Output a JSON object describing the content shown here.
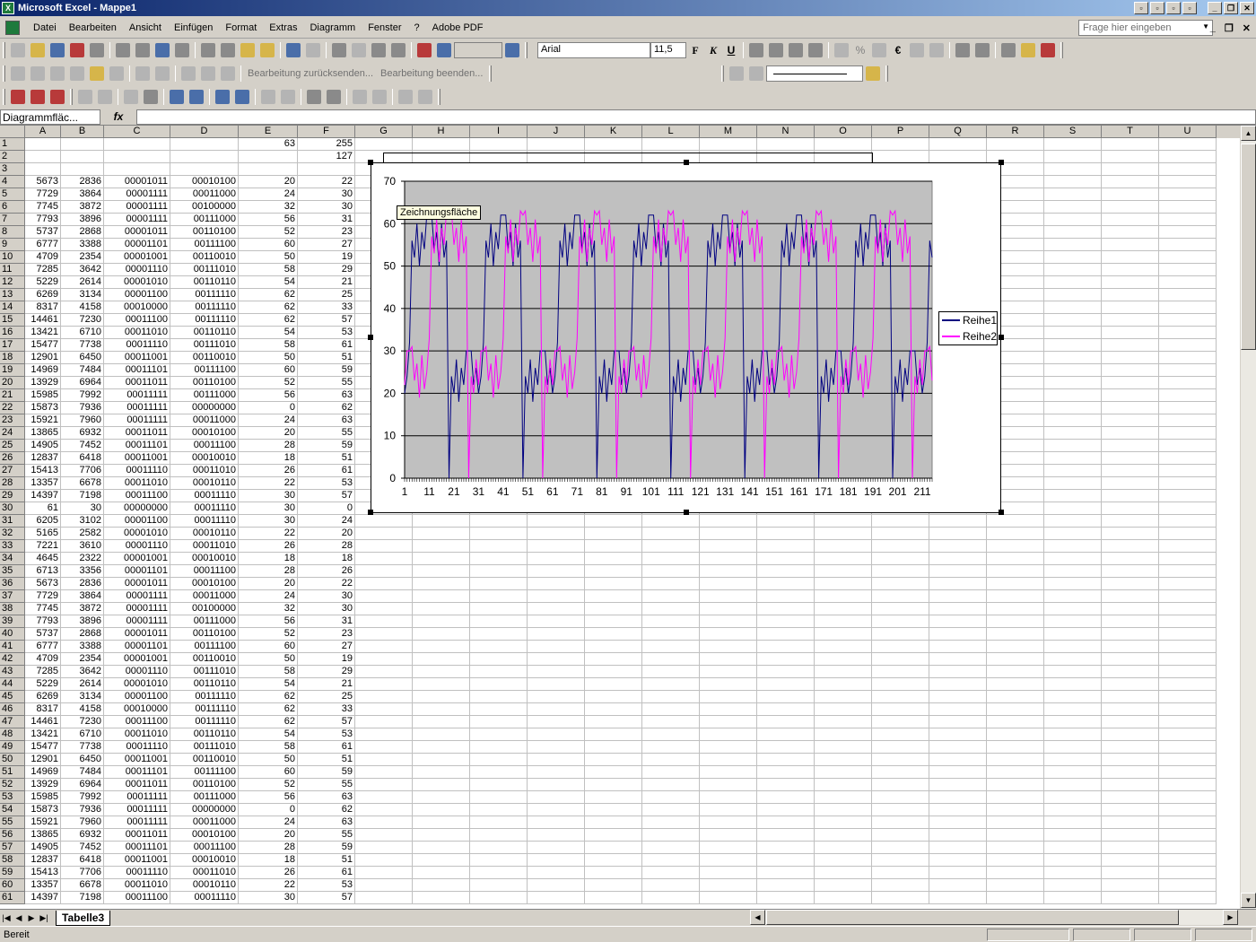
{
  "window": {
    "title": "Microsoft Excel - Mappe1"
  },
  "menu": {
    "items": [
      "Datei",
      "Bearbeiten",
      "Ansicht",
      "Einfügen",
      "Format",
      "Extras",
      "Diagramm",
      "Fenster",
      "?",
      "Adobe PDF"
    ],
    "help_placeholder": "Frage hier eingeben"
  },
  "toolbar": {
    "font_name": "Arial",
    "font_size": "11,5",
    "bold": "F",
    "italic": "K",
    "underline": "U",
    "euro": "€",
    "percent": "%",
    "review_reply": "Bearbeitung zurücksenden...",
    "review_end": "Bearbeitung beenden..."
  },
  "formula_bar": {
    "name_box": "Diagrammfläc...",
    "fx": "fx"
  },
  "columns": [
    "A",
    "B",
    "C",
    "D",
    "E",
    "F",
    "G",
    "H",
    "I",
    "J",
    "K",
    "L",
    "M",
    "N",
    "O",
    "P",
    "Q",
    "R",
    "S",
    "T",
    "U"
  ],
  "rows": [
    [
      "1",
      "",
      "",
      "",
      "",
      "63",
      "255"
    ],
    [
      "2",
      "",
      "",
      "",
      "",
      "",
      "127"
    ],
    [
      "3",
      "",
      "",
      "",
      "",
      "",
      ""
    ],
    [
      "4",
      "5673",
      "2836",
      "00001011",
      "00010100",
      "20",
      "22"
    ],
    [
      "5",
      "7729",
      "3864",
      "00001111",
      "00011000",
      "24",
      "30"
    ],
    [
      "6",
      "7745",
      "3872",
      "00001111",
      "00100000",
      "32",
      "30"
    ],
    [
      "7",
      "7793",
      "3896",
      "00001111",
      "00111000",
      "56",
      "31"
    ],
    [
      "8",
      "5737",
      "2868",
      "00001011",
      "00110100",
      "52",
      "23"
    ],
    [
      "9",
      "6777",
      "3388",
      "00001101",
      "00111100",
      "60",
      "27"
    ],
    [
      "10",
      "4709",
      "2354",
      "00001001",
      "00110010",
      "50",
      "19"
    ],
    [
      "11",
      "7285",
      "3642",
      "00001110",
      "00111010",
      "58",
      "29"
    ],
    [
      "12",
      "5229",
      "2614",
      "00001010",
      "00110110",
      "54",
      "21"
    ],
    [
      "13",
      "6269",
      "3134",
      "00001100",
      "00111110",
      "62",
      "25"
    ],
    [
      "14",
      "8317",
      "4158",
      "00010000",
      "00111110",
      "62",
      "33"
    ],
    [
      "15",
      "14461",
      "7230",
      "00011100",
      "00111110",
      "62",
      "57"
    ],
    [
      "16",
      "13421",
      "6710",
      "00011010",
      "00110110",
      "54",
      "53"
    ],
    [
      "17",
      "15477",
      "7738",
      "00011110",
      "00111010",
      "58",
      "61"
    ],
    [
      "18",
      "12901",
      "6450",
      "00011001",
      "00110010",
      "50",
      "51"
    ],
    [
      "19",
      "14969",
      "7484",
      "00011101",
      "00111100",
      "60",
      "59"
    ],
    [
      "20",
      "13929",
      "6964",
      "00011011",
      "00110100",
      "52",
      "55"
    ],
    [
      "21",
      "15985",
      "7992",
      "00011111",
      "00111000",
      "56",
      "63"
    ],
    [
      "22",
      "15873",
      "7936",
      "00011111",
      "00000000",
      "0",
      "62"
    ],
    [
      "23",
      "15921",
      "7960",
      "00011111",
      "00011000",
      "24",
      "63"
    ],
    [
      "24",
      "13865",
      "6932",
      "00011011",
      "00010100",
      "20",
      "55"
    ],
    [
      "25",
      "14905",
      "7452",
      "00011101",
      "00011100",
      "28",
      "59"
    ],
    [
      "26",
      "12837",
      "6418",
      "00011001",
      "00010010",
      "18",
      "51"
    ],
    [
      "27",
      "15413",
      "7706",
      "00011110",
      "00011010",
      "26",
      "61"
    ],
    [
      "28",
      "13357",
      "6678",
      "00011010",
      "00010110",
      "22",
      "53"
    ],
    [
      "29",
      "14397",
      "7198",
      "00011100",
      "00011110",
      "30",
      "57"
    ],
    [
      "30",
      "61",
      "30",
      "00000000",
      "00011110",
      "30",
      "0"
    ],
    [
      "31",
      "6205",
      "3102",
      "00001100",
      "00011110",
      "30",
      "24"
    ],
    [
      "32",
      "5165",
      "2582",
      "00001010",
      "00010110",
      "22",
      "20"
    ],
    [
      "33",
      "7221",
      "3610",
      "00001110",
      "00011010",
      "26",
      "28"
    ],
    [
      "34",
      "4645",
      "2322",
      "00001001",
      "00010010",
      "18",
      "18"
    ],
    [
      "35",
      "6713",
      "3356",
      "00001101",
      "00011100",
      "28",
      "26"
    ],
    [
      "36",
      "5673",
      "2836",
      "00001011",
      "00010100",
      "20",
      "22"
    ],
    [
      "37",
      "7729",
      "3864",
      "00001111",
      "00011000",
      "24",
      "30"
    ],
    [
      "38",
      "7745",
      "3872",
      "00001111",
      "00100000",
      "32",
      "30"
    ],
    [
      "39",
      "7793",
      "3896",
      "00001111",
      "00111000",
      "56",
      "31"
    ],
    [
      "40",
      "5737",
      "2868",
      "00001011",
      "00110100",
      "52",
      "23"
    ],
    [
      "41",
      "6777",
      "3388",
      "00001101",
      "00111100",
      "60",
      "27"
    ],
    [
      "42",
      "4709",
      "2354",
      "00001001",
      "00110010",
      "50",
      "19"
    ],
    [
      "43",
      "7285",
      "3642",
      "00001110",
      "00111010",
      "58",
      "29"
    ],
    [
      "44",
      "5229",
      "2614",
      "00001010",
      "00110110",
      "54",
      "21"
    ],
    [
      "45",
      "6269",
      "3134",
      "00001100",
      "00111110",
      "62",
      "25"
    ],
    [
      "46",
      "8317",
      "4158",
      "00010000",
      "00111110",
      "62",
      "33"
    ],
    [
      "47",
      "14461",
      "7230",
      "00011100",
      "00111110",
      "62",
      "57"
    ],
    [
      "48",
      "13421",
      "6710",
      "00011010",
      "00110110",
      "54",
      "53"
    ],
    [
      "49",
      "15477",
      "7738",
      "00011110",
      "00111010",
      "58",
      "61"
    ],
    [
      "50",
      "12901",
      "6450",
      "00011001",
      "00110010",
      "50",
      "51"
    ],
    [
      "51",
      "14969",
      "7484",
      "00011101",
      "00111100",
      "60",
      "59"
    ],
    [
      "52",
      "13929",
      "6964",
      "00011011",
      "00110100",
      "52",
      "55"
    ],
    [
      "53",
      "15985",
      "7992",
      "00011111",
      "00111000",
      "56",
      "63"
    ],
    [
      "54",
      "15873",
      "7936",
      "00011111",
      "00000000",
      "0",
      "62"
    ],
    [
      "55",
      "15921",
      "7960",
      "00011111",
      "00011000",
      "24",
      "63"
    ],
    [
      "56",
      "13865",
      "6932",
      "00011011",
      "00010100",
      "20",
      "55"
    ],
    [
      "57",
      "14905",
      "7452",
      "00011101",
      "00011100",
      "28",
      "59"
    ],
    [
      "58",
      "12837",
      "6418",
      "00011001",
      "00010010",
      "18",
      "51"
    ],
    [
      "59",
      "15413",
      "7706",
      "00011110",
      "00011010",
      "26",
      "61"
    ],
    [
      "60",
      "13357",
      "6678",
      "00011010",
      "00010110",
      "22",
      "53"
    ],
    [
      "61",
      "14397",
      "7198",
      "00011100",
      "00011110",
      "30",
      "57"
    ]
  ],
  "chart": {
    "tooltip": "Zeichnungsfläche",
    "plot_bg": "#c0c0c0",
    "series_colors": [
      "#000080",
      "#ff00ff"
    ]
  },
  "chart_data": {
    "type": "line",
    "title": "",
    "xlabel": "",
    "ylabel": "",
    "ylim": [
      0,
      70
    ],
    "yticks": [
      0,
      10,
      20,
      30,
      40,
      50,
      60,
      70
    ],
    "xlim": [
      1,
      215
    ],
    "xtick_labels": [
      "1",
      "11",
      "21",
      "31",
      "41",
      "51",
      "61",
      "71",
      "81",
      "91",
      "101",
      "111",
      "121",
      "131",
      "141",
      "151",
      "161",
      "171",
      "181",
      "191",
      "201",
      "211"
    ],
    "legend_position": "right",
    "grid": true,
    "period": 30,
    "series": [
      {
        "name": "Reihe1",
        "cycle": [
          20,
          24,
          32,
          56,
          52,
          60,
          50,
          58,
          54,
          62,
          62,
          62,
          54,
          58,
          50,
          60,
          52,
          56,
          0,
          24,
          20,
          28,
          18,
          26,
          22,
          30,
          30,
          30,
          22,
          26
        ]
      },
      {
        "name": "Reihe2",
        "cycle": [
          22,
          30,
          30,
          31,
          23,
          27,
          19,
          29,
          21,
          25,
          33,
          57,
          53,
          61,
          51,
          59,
          55,
          63,
          62,
          63,
          55,
          59,
          51,
          61,
          53,
          57,
          0,
          24,
          20,
          28
        ]
      }
    ]
  },
  "sheet_tab": "Tabelle3",
  "status": "Bereit"
}
